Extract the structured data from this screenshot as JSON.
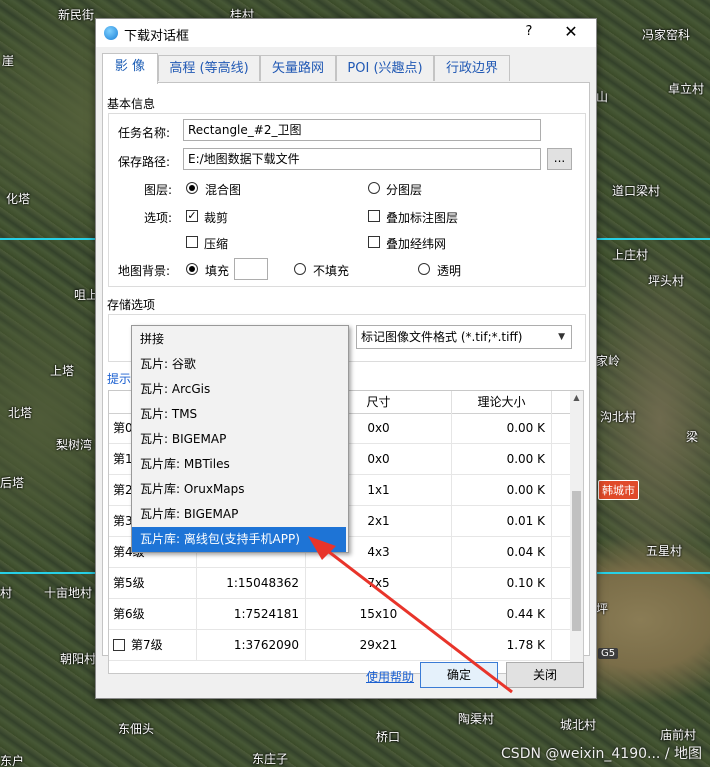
{
  "map": {
    "labels": [
      "新民街",
      "崖",
      "化塔",
      "咀上",
      "上塔",
      "北塔",
      "梨树湾",
      "后塔",
      "十亩地村",
      "朝阳村",
      "东佃头",
      "东庄子",
      "桥口",
      "陶渠村",
      "城北村",
      "庙前村",
      "冯家窑科",
      "卓立村",
      "道口梁村",
      "上庄村",
      "坪头村",
      "家岭",
      "沟北村",
      "梁",
      "五星村",
      "山",
      "桂村",
      "村",
      "东户",
      "坪"
    ],
    "badges": {
      "city": "韩城市",
      "road": "G5"
    },
    "watermark": "CSDN @weixin_4190... / 地图"
  },
  "dialog": {
    "title": "下载对话框",
    "help": "?",
    "close": "✕",
    "tabs": [
      "影 像",
      "高程 (等高线)",
      "矢量路网",
      "POI (兴趣点)",
      "行政边界"
    ],
    "basic_info": {
      "section": "基本信息",
      "task_name_label": "任务名称:",
      "task_name_value": "Rectangle_#2_卫图",
      "save_path_label": "保存路径:",
      "save_path_value": "E:/地图数据下载文件",
      "browse": "...",
      "layer_label": "图层:",
      "layer_mixed": "混合图",
      "layer_split": "分图层",
      "options_label": "选项:",
      "opt_crop": "裁剪",
      "opt_overlay_label": "叠加标注图层",
      "opt_compress": "压缩",
      "opt_overlay_grid": "叠加经纬网",
      "bg_label": "地图背景:",
      "bg_fill": "填充",
      "bg_nofill": "不填充",
      "bg_transparent": "透明"
    },
    "storage": {
      "section": "存储选项",
      "format_value": "标记图像文件格式 (*.tif;*.tiff)",
      "hint": "提示"
    },
    "dropdown_options": [
      "拼接",
      "瓦片: 谷歌",
      "瓦片: ArcGis",
      "瓦片: TMS",
      "瓦片: BIGEMAP",
      "瓦片库: MBTiles",
      "瓦片库: OruxMaps",
      "瓦片库: BIGEMAP",
      "瓦片库: 离线包(支持手机APP)"
    ],
    "selected_option_index": 8,
    "table": {
      "headers": [
        "",
        "",
        "尺寸",
        "理论大小"
      ],
      "rows": [
        {
          "level": "第0级",
          "scale": "",
          "size": "0x0",
          "bytes": "0.00 K"
        },
        {
          "level": "第1级",
          "scale": "",
          "size": "0x0",
          "bytes": "0.00 K"
        },
        {
          "level": "第2级",
          "scale": "",
          "size": "1x1",
          "bytes": "0.00 K"
        },
        {
          "level": "第3级",
          "scale": "",
          "size": "2x1",
          "bytes": "0.01 K"
        },
        {
          "level": "第4级",
          "scale": "",
          "size": "4x3",
          "bytes": "0.04 K"
        },
        {
          "level": "第5级",
          "scale": "1:15048362",
          "size": "7x5",
          "bytes": "0.10 K"
        },
        {
          "level": "第6级",
          "scale": "1:7524181",
          "size": "15x10",
          "bytes": "0.44 K"
        },
        {
          "level": "第7级",
          "scale": "1:3762090",
          "size": "29x21",
          "bytes": "1.78 K"
        }
      ]
    },
    "footer": {
      "help_link": "使用帮助",
      "ok": "确定",
      "close": "关闭"
    }
  },
  "colors": {
    "accent": "#1e74d6",
    "link": "#1a5fd0",
    "arrow": "#e8342a",
    "tab_text": "#2159b4"
  }
}
